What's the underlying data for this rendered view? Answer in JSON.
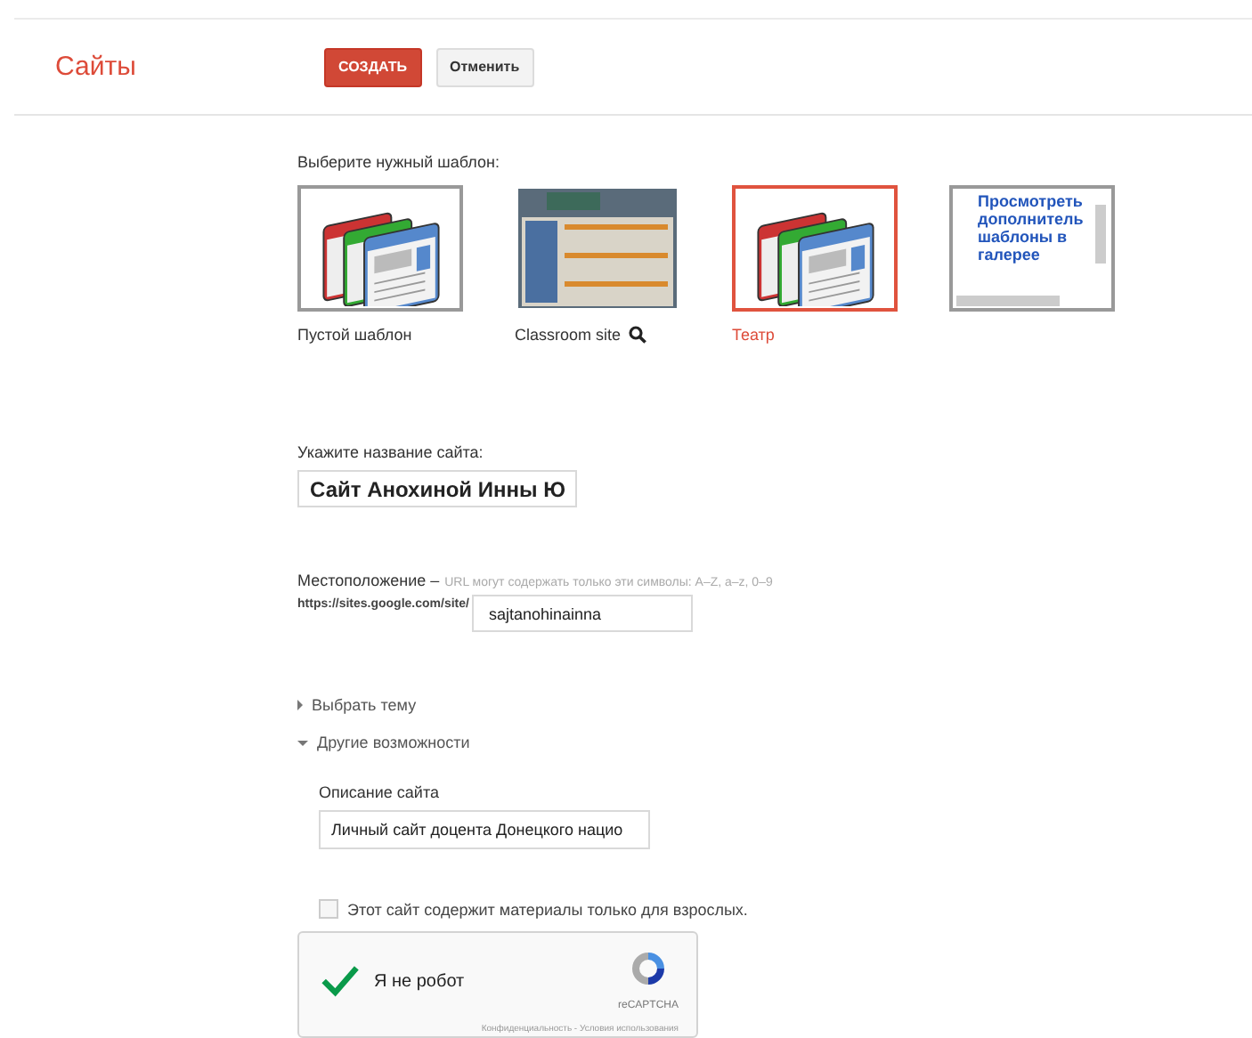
{
  "header": {
    "title": "Сайты",
    "buttons": [
      {
        "label": "СОЗДАТЬ",
        "kind": "primary"
      },
      {
        "label": "Отменить",
        "kind": "secondary"
      }
    ]
  },
  "templates": {
    "label": "Выберите нужный шаблон:",
    "items": [
      {
        "kind": "icon",
        "label": "Пустой шаблон",
        "selected": false
      },
      {
        "kind": "photo",
        "label": "Classroom site",
        "selected": false,
        "search": true
      },
      {
        "kind": "icon",
        "label": "Театр",
        "selected": true
      },
      {
        "kind": "gallery",
        "link": "Просмотреть дополнитель шаблоны в галерее",
        "selected": false
      }
    ]
  },
  "site_name": {
    "label": "Укажите название сайта:",
    "value": "Сайт Анохиной Инны Ю"
  },
  "location": {
    "label": "Местоположение –",
    "hint": "URL могут содержать только эти символы: A–Z, a–z, 0–9",
    "prefix": "https://sites.google.com/site/",
    "value": "sajtanohinainna"
  },
  "sections": [
    {
      "label": "Выбрать тему",
      "expanded": false
    },
    {
      "label": "Другие возможности",
      "expanded": true
    }
  ],
  "description": {
    "label": "Описание сайта",
    "value": "Личный сайт доцента Донецкого нацио"
  },
  "adult": {
    "label": "Этот сайт содержит материалы только для взрослых.",
    "checked": false
  },
  "captcha": {
    "label": "Я не робот",
    "checked": true,
    "brand": "reCAPTCHA",
    "links": "Конфиденциальность - Условия использования"
  }
}
